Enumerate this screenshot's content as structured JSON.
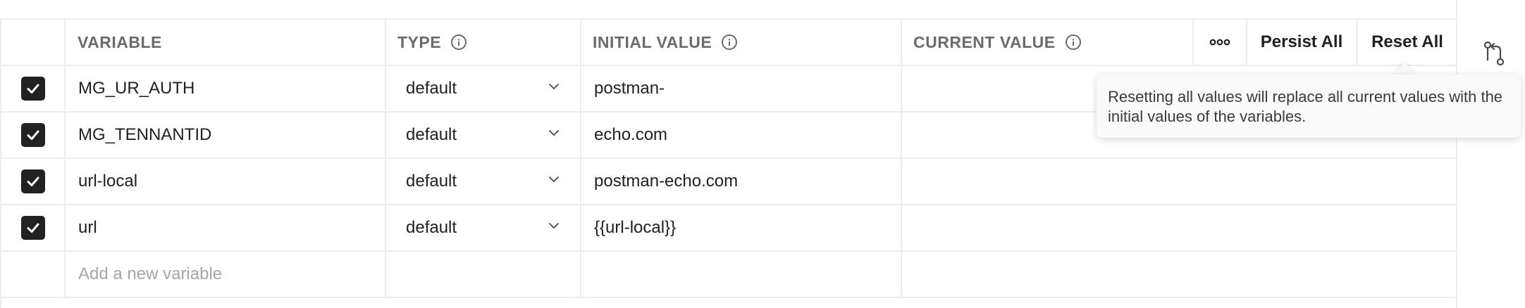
{
  "header": {
    "variable": "VARIABLE",
    "type": "TYPE",
    "initial_value": "INITIAL VALUE",
    "current_value": "CURRENT VALUE",
    "more_label": "ooo",
    "persist_all": "Persist All",
    "reset_all": "Reset All"
  },
  "rows": [
    {
      "checked": true,
      "variable": "MG_UR_AUTH",
      "type": "default",
      "initial_value": "postman-",
      "current_value": ""
    },
    {
      "checked": true,
      "variable": "MG_TENNANTID",
      "type": "default",
      "initial_value": "echo.com",
      "current_value": ""
    },
    {
      "checked": true,
      "variable": "url-local",
      "type": "default",
      "initial_value": "postman-echo.com",
      "current_value": ""
    },
    {
      "checked": true,
      "variable": "url",
      "type": "default",
      "initial_value": "{{url-local}}",
      "current_value": ""
    }
  ],
  "new_row": {
    "placeholder": "Add a new variable"
  },
  "tooltip": {
    "text": "Resetting all values will replace all current values with the initial values of the variables."
  },
  "icons": {
    "info": "info-icon",
    "chevron": "chevron-down-icon",
    "check": "check-icon",
    "side": "pull-request-icon"
  },
  "colors": {
    "checkbox_fill": "#212121",
    "border": "#ececec",
    "header_text": "#6b6b6b",
    "placeholder": "#a6a6a6"
  }
}
